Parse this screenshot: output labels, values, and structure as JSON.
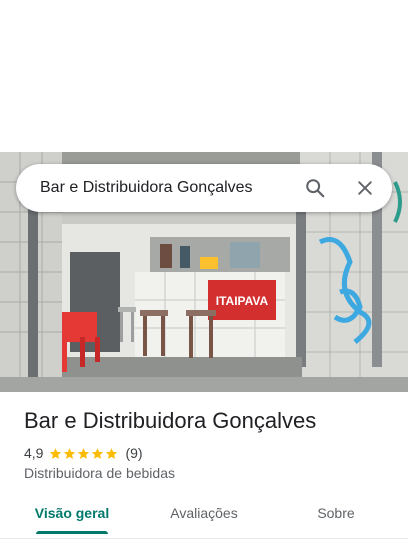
{
  "search": {
    "query": "Bar e Distribuidora Gonçalves"
  },
  "photo": {
    "sign_text": "ITAIPAVA"
  },
  "place": {
    "name": "Bar e Distribuidora Gonçalves",
    "rating": "4,9",
    "stars": 5,
    "review_count": "(9)",
    "category": "Distribuidora de bebidas"
  },
  "tabs": [
    {
      "label": "Visão geral",
      "active": true
    },
    {
      "label": "Avaliações",
      "active": false
    },
    {
      "label": "Sobre",
      "active": false
    }
  ],
  "colors": {
    "accent": "#00796b",
    "star": "#fbbc04",
    "sign": "#d32f2f"
  }
}
